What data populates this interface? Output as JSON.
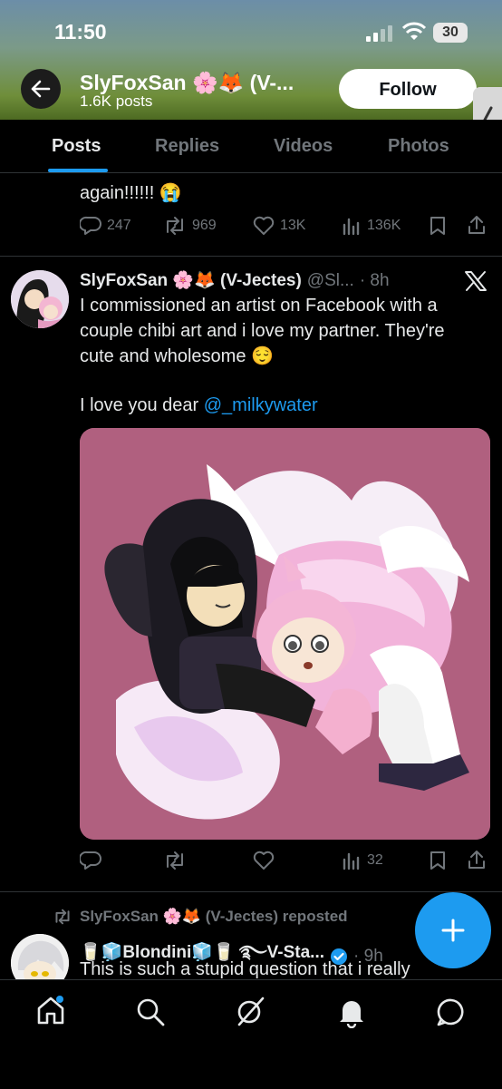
{
  "status_bar": {
    "time": "11:50",
    "battery": "30"
  },
  "header": {
    "name": "SlyFoxSan 🌸🦊 (V-...",
    "post_count": "1.6K posts",
    "follow_label": "Follow"
  },
  "tabs": [
    {
      "label": "Posts"
    },
    {
      "label": "Replies"
    },
    {
      "label": "Videos"
    },
    {
      "label": "Photos"
    }
  ],
  "prev_tweet": {
    "text_tail": "again!!!!!! 😭",
    "replies": "247",
    "reposts": "969",
    "likes": "13K",
    "views": "136K"
  },
  "tweet": {
    "author": "SlyFoxSan 🌸🦊 (V-Jectes)",
    "handle": "@Sl...",
    "time": "· 8h",
    "text_lines": [
      "I commissioned an artist on Facebook with a",
      "couple chibi art and i love my partner. They're",
      "cute and wholesome 😌"
    ],
    "text_prefix": "I love you dear ",
    "mention": "@_milkywater",
    "views": "32"
  },
  "next_tweet": {
    "repost_label": "SlyFoxSan 🌸🦊 (V-Jectes) reposted",
    "author": "🥛🧊Blondini🧊🥛 ࿐V-Sta...",
    "time": "· 9h",
    "text": "This is such a stupid question that i really"
  },
  "colors": {
    "accent": "#1d9bf0",
    "background": "#000000",
    "image_bg": "#b0607f",
    "muted": "#71767b"
  }
}
